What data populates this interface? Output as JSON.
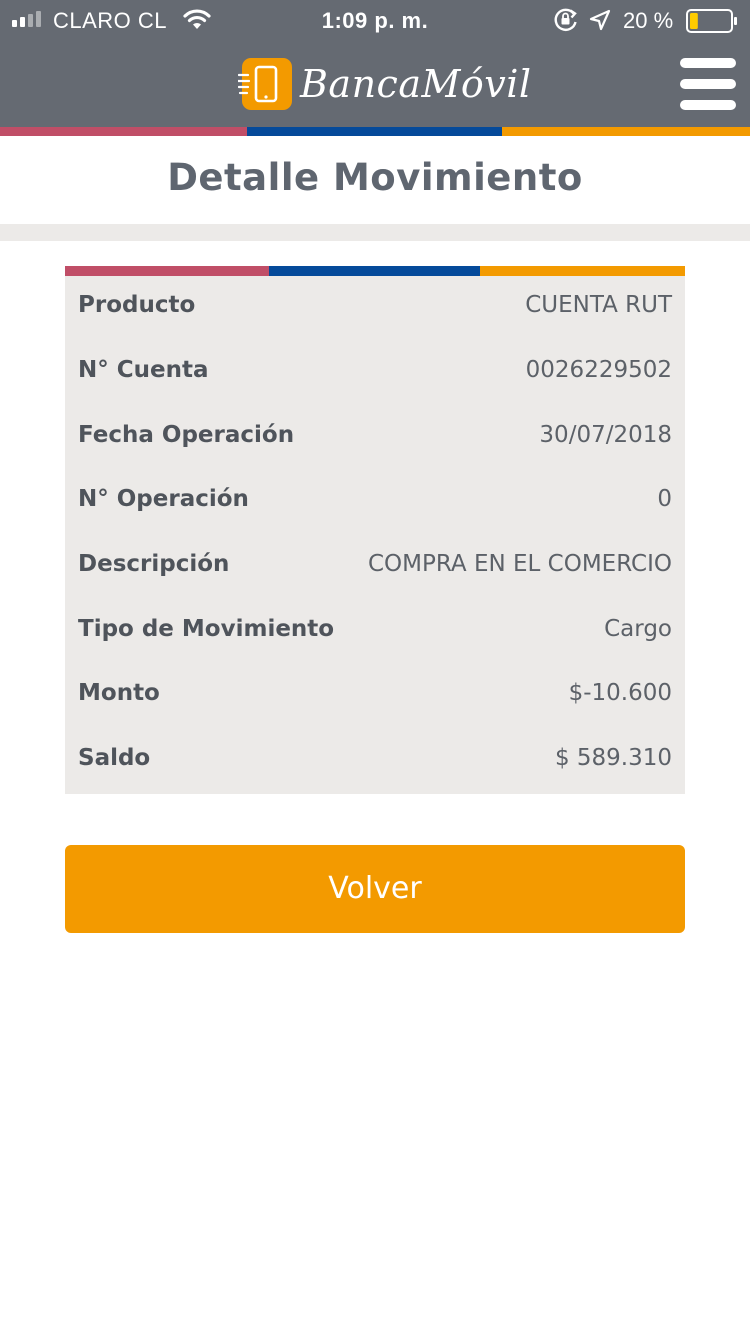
{
  "status_bar": {
    "carrier": "CLARO CL",
    "time": "1:09 p. m.",
    "battery_percent": "20 %",
    "battery_level": 0.2
  },
  "header": {
    "app_name": "BancaMóvil",
    "logo_icon": "phone-icon",
    "menu_icon": "hamburger-icon"
  },
  "colors": {
    "header_bg": "#656a72",
    "stripe_red": "#c04e67",
    "stripe_blue": "#054a9a",
    "stripe_orange": "#f39a00",
    "card_bg": "#eceae8",
    "button_bg": "#f39a00"
  },
  "page": {
    "title": "Detalle Movimiento"
  },
  "details": [
    {
      "label": "Producto",
      "value": "CUENTA RUT"
    },
    {
      "label": "N° Cuenta",
      "value": "0026229502"
    },
    {
      "label": "Fecha Operación",
      "value": "30/07/2018"
    },
    {
      "label": "N° Operación",
      "value": "0"
    },
    {
      "label": "Descripción",
      "value": "COMPRA EN EL COMERCIO"
    },
    {
      "label": "Tipo de Movimiento",
      "value": "Cargo"
    },
    {
      "label": "Monto",
      "value": "$-10.600"
    },
    {
      "label": "Saldo",
      "value": "$ 589.310"
    }
  ],
  "actions": {
    "back_label": "Volver"
  }
}
